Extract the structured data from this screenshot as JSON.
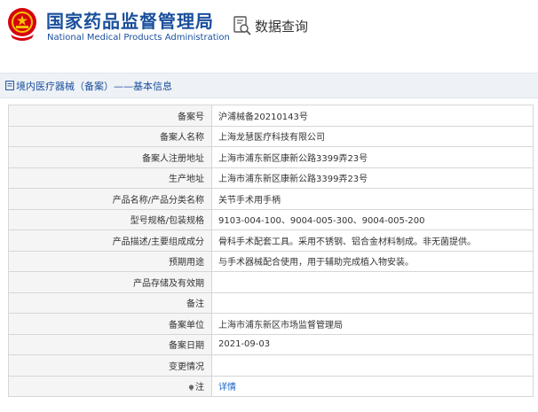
{
  "header": {
    "org_name_cn": "国家药品监督管理局",
    "org_name_en": "National Medical Products Administration",
    "query_title": "数据查询",
    "brand_color": "#1a4f9c",
    "emblem_color": "#d7000f"
  },
  "breadcrumb": {
    "text": "境内医疗器械（备案）——基本信息"
  },
  "record": {
    "rows": [
      {
        "label": "备案号",
        "value": "沪浦械备20210143号"
      },
      {
        "label": "备案人名称",
        "value": "上海龙慧医疗科技有限公司"
      },
      {
        "label": "备案人注册地址",
        "value": "上海市浦东新区康新公路3399弄23号"
      },
      {
        "label": "生产地址",
        "value": "上海市浦东新区康新公路3399弄23号"
      },
      {
        "label": "产品名称/产品分类名称",
        "value": "关节手术用手柄"
      },
      {
        "label": "型号规格/包装规格",
        "value": "9103-004-100、9004-005-300、9004-005-200"
      },
      {
        "label": "产品描述/主要组成成分",
        "value": "骨科手术配套工具。采用不锈钢、铝合金材料制成。非无菌提供。"
      },
      {
        "label": "预期用途",
        "value": "与手术器械配合使用，用于辅助完成植入物安装。"
      },
      {
        "label": "产品存储及有效期",
        "value": ""
      },
      {
        "label": "备注",
        "value": ""
      },
      {
        "label": "备案单位",
        "value": "上海市浦东新区市场监督管理局"
      },
      {
        "label": "备案日期",
        "value": "2021-09-03"
      },
      {
        "label": "变更情况",
        "value": ""
      },
      {
        "label": "注",
        "value": "详情",
        "icon": "lightbulb-icon"
      }
    ]
  }
}
